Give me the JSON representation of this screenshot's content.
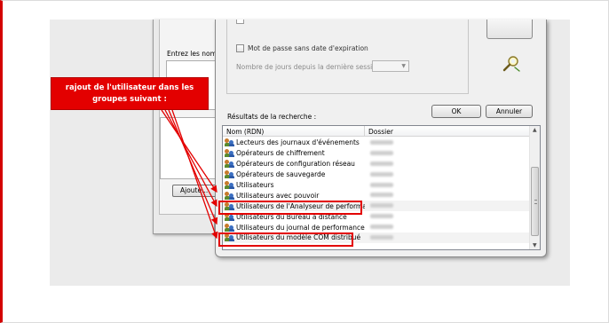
{
  "annotation": {
    "callout_line1": "rajout de l'utilisateur dans les",
    "callout_line2": "groupes suivant :",
    "accent_color": "#e30000"
  },
  "back_dialog": {
    "enter_names_label": "Entrez les noms",
    "add_button": "Ajoute..."
  },
  "options": {
    "no_expire_password_label": "Mot de passe sans date d'expiration",
    "days_since_last_session_label": "Nombre de jours depuis la dernière session :",
    "days_select_value": ""
  },
  "buttons": {
    "ok": "OK",
    "cancel": "Annuler"
  },
  "results": {
    "label": "Résultats de la recherche :",
    "columns": {
      "name": "Nom (RDN)",
      "folder": "Dossier"
    },
    "rows": [
      {
        "name": "Lecteurs des journaux d'événements",
        "highlighted": false
      },
      {
        "name": "Opérateurs de chiffrement",
        "highlighted": false
      },
      {
        "name": "Opérateurs de configuration réseau",
        "highlighted": false
      },
      {
        "name": "Opérateurs de sauvegarde",
        "highlighted": false
      },
      {
        "name": "Utilisateurs",
        "highlighted": false
      },
      {
        "name": "Utilisateurs avec pouvoir",
        "highlighted": false
      },
      {
        "name": "Utilisateurs de l'Analyseur de performances",
        "highlighted": true
      },
      {
        "name": "Utilisateurs du Bureau à distance",
        "highlighted": false
      },
      {
        "name": "Utilisateurs du journal de performances",
        "highlighted": false
      },
      {
        "name": "Utilisateurs du modèle COM distribué",
        "highlighted": true
      }
    ]
  },
  "icons": [
    "group-icon",
    "find-icon",
    "scroll-up-icon",
    "scroll-down-icon",
    "dropdown-arrow-icon"
  ]
}
